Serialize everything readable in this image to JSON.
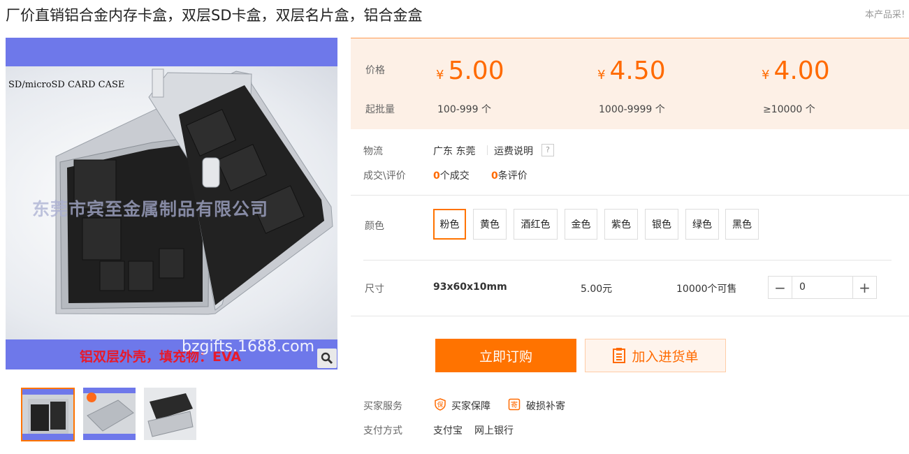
{
  "product": {
    "title": "厂价直销铝合金内存卡盒，双层SD卡盒，双层名片盒，铝合金盒",
    "notice": "本产品采!"
  },
  "image": {
    "card_title": "SD/microSD  CARD CASE",
    "watermark": "东莞市宾至金属制品有限公司",
    "caption": "铝双层外壳，填充物：EVA",
    "url": "bzgifts.1688.com",
    "zoom_icon": "magnifier-icon"
  },
  "price": {
    "price_label": "价格",
    "batch_label": "起批量",
    "currency": "¥",
    "tiers": [
      {
        "price": "5.00",
        "quantity": "100-999 个"
      },
      {
        "price": "4.50",
        "quantity": "1000-9999 个"
      },
      {
        "price": "4.00",
        "quantity": "≥10000 个"
      }
    ],
    "accent_color": "#ff6a00"
  },
  "logistics": {
    "label": "物流",
    "location": "广东 东莞",
    "shipping_link": "运费说明",
    "help": "?"
  },
  "deals": {
    "label": "成交\\评价",
    "deal_count": "0",
    "deal_unit": "个成交",
    "review_count": "0",
    "review_unit": "条评价"
  },
  "colors": {
    "label": "颜色",
    "options": [
      "粉色",
      "黄色",
      "酒红色",
      "金色",
      "紫色",
      "银色",
      "绿色",
      "黑色"
    ],
    "selected": "粉色"
  },
  "size": {
    "label": "尺寸",
    "value": "93x60x10mm",
    "price": "5.00元",
    "stock": "10000个可售",
    "quantity": "0",
    "minus": "−",
    "plus": "+"
  },
  "actions": {
    "buy": "立即订购",
    "add_cart": "加入进货单"
  },
  "services": {
    "label": "买家服务",
    "items": [
      {
        "icon": "bao",
        "text": "买家保障"
      },
      {
        "icon": "ji",
        "text": "破损补寄"
      }
    ]
  },
  "payment": {
    "label": "支付方式",
    "methods": [
      "支付宝",
      "网上银行"
    ]
  }
}
